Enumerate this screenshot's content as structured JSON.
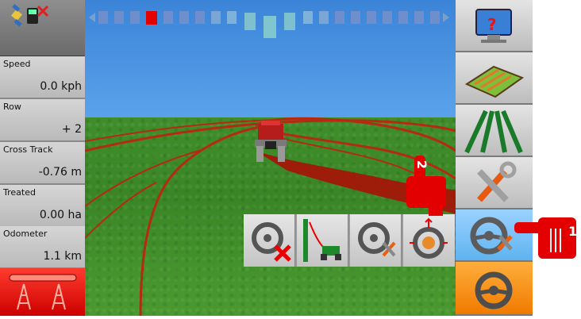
{
  "stats": [
    {
      "label": "Speed",
      "value": "0.0 kph"
    },
    {
      "label": "Row",
      "value": "+ 2"
    },
    {
      "label": "Cross Track",
      "value": "-0.76 m"
    },
    {
      "label": "Treated",
      "value": "0.00 ha"
    },
    {
      "label": "Odometer",
      "value": "1.1 km"
    }
  ],
  "callouts": [
    {
      "number": "2"
    },
    {
      "number": "1"
    }
  ],
  "colors": {
    "accent_red": "#e20000",
    "active_blue": "#6fbdf5",
    "orange": "#f28c0f",
    "grass": "#3f8d2b",
    "sky": "#4a93e2"
  },
  "right_panel_icons": [
    "help-monitor-icon",
    "field-map-icon",
    "guidance-lines-icon",
    "tools-settings-icon",
    "steering-settings-icon",
    "steering-engage-icon"
  ],
  "popup_icons": [
    "steering-disable-icon",
    "sensitivity-icon",
    "steering-tools-icon",
    "steering-calibrate-icon"
  ]
}
